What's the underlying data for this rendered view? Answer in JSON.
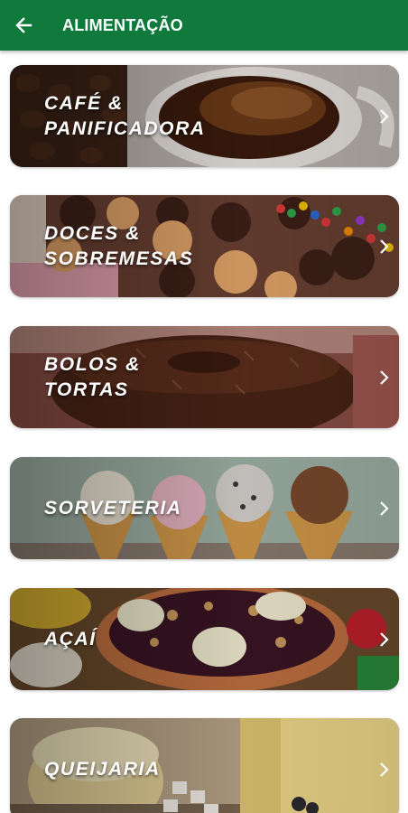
{
  "header": {
    "title": "ALIMENTAÇÃO",
    "back_icon": "arrow-back-icon",
    "color": "#0f7a3c"
  },
  "categories": [
    {
      "label": "CAFÉ &\nPANIFICADORA",
      "icon": "chevron-right-icon"
    },
    {
      "label": "DOCES &\nSOBREMESAS",
      "icon": "chevron-right-icon"
    },
    {
      "label": "BOLOS &\nTORTAS",
      "icon": "chevron-right-icon"
    },
    {
      "label": "SORVETERIA",
      "icon": "chevron-right-icon"
    },
    {
      "label": "AÇAÍ",
      "icon": "chevron-right-icon"
    },
    {
      "label": "QUEIJARIA",
      "icon": "chevron-right-icon"
    }
  ]
}
